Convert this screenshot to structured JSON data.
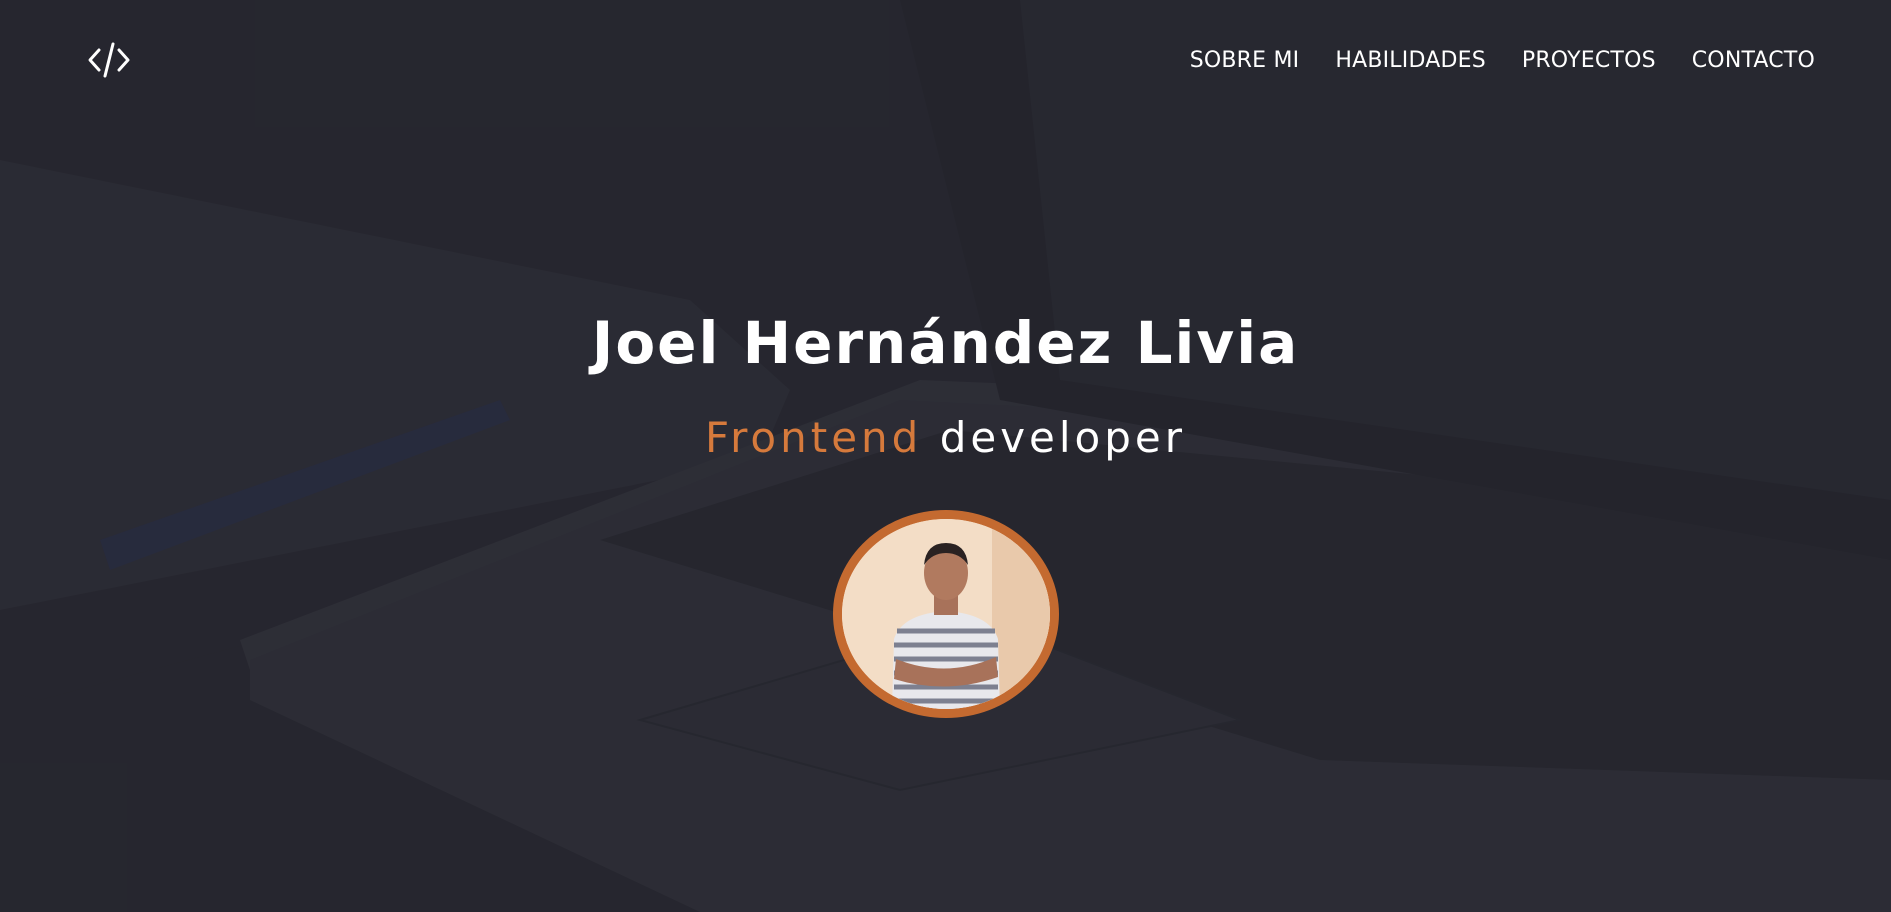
{
  "nav": {
    "logo_icon": "code-brackets-icon",
    "items": [
      {
        "label": "SOBRE MI"
      },
      {
        "label": "HABILIDADES"
      },
      {
        "label": "PROYECTOS"
      },
      {
        "label": "CONTACTO"
      }
    ]
  },
  "hero": {
    "name": "Joel Hernández Livia",
    "role_accent": "Frontend",
    "role_rest": "developer",
    "avatar_icon": "profile-photo"
  },
  "colors": {
    "accent": "#d67a3c",
    "avatar_border": "#c46a30",
    "text": "#ffffff"
  }
}
